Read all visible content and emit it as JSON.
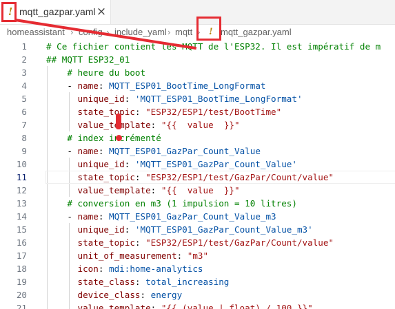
{
  "tab": {
    "warn_glyph": "!",
    "label": "mqtt_gazpar.yaml",
    "close_glyph": "×"
  },
  "breadcrumb": {
    "items": [
      "homeassistant",
      "config",
      "include_yaml",
      "mqtt"
    ],
    "separator": "›",
    "warn_glyph": "!",
    "file": "mqtt_gazpar.yaml"
  },
  "editor": {
    "current_line": 11,
    "lines": [
      {
        "n": "1",
        "segments": [
          {
            "t": "# Ce fichier contient les MQTT de l'ESP32. Il est impératif de m",
            "c": "comment"
          }
        ]
      },
      {
        "n": "2",
        "segments": [
          {
            "t": "## MQTT ESP32_01",
            "c": "comment"
          }
        ]
      },
      {
        "n": "3",
        "segments": [
          {
            "t": "    ",
            "c": "punct"
          },
          {
            "t": "# heure du boot",
            "c": "comment"
          }
        ]
      },
      {
        "n": "4",
        "segments": [
          {
            "t": "    - ",
            "c": "punct"
          },
          {
            "t": "name",
            "c": "key"
          },
          {
            "t": ": ",
            "c": "punct"
          },
          {
            "t": "MQTT_ESP01_BootTime_LongFormat",
            "c": "val"
          }
        ]
      },
      {
        "n": "5",
        "segments": [
          {
            "t": "      ",
            "c": "punct"
          },
          {
            "t": "unique_id",
            "c": "key"
          },
          {
            "t": ": ",
            "c": "punct"
          },
          {
            "t": "'MQTT_ESP01_BootTime_LongFormat'",
            "c": "val"
          }
        ]
      },
      {
        "n": "6",
        "segments": [
          {
            "t": "      ",
            "c": "punct"
          },
          {
            "t": "state_topic",
            "c": "key"
          },
          {
            "t": ": ",
            "c": "punct"
          },
          {
            "t": "\"ESP32/ESP1/test/BootTime\"",
            "c": "str"
          }
        ]
      },
      {
        "n": "7",
        "segments": [
          {
            "t": "      ",
            "c": "punct"
          },
          {
            "t": "value_template",
            "c": "key"
          },
          {
            "t": ": ",
            "c": "punct"
          },
          {
            "t": "\"{{  value  }}\"",
            "c": "str"
          }
        ]
      },
      {
        "n": "8",
        "segments": [
          {
            "t": "    ",
            "c": "punct"
          },
          {
            "t": "# index incrémenté",
            "c": "comment"
          }
        ]
      },
      {
        "n": "9",
        "segments": [
          {
            "t": "    - ",
            "c": "punct"
          },
          {
            "t": "name",
            "c": "key"
          },
          {
            "t": ": ",
            "c": "punct"
          },
          {
            "t": "MQTT_ESP01_GazPar_Count_Value",
            "c": "val"
          }
        ]
      },
      {
        "n": "10",
        "segments": [
          {
            "t": "      ",
            "c": "punct"
          },
          {
            "t": "unique_id",
            "c": "key"
          },
          {
            "t": ": ",
            "c": "punct"
          },
          {
            "t": "'MQTT_ESP01_GazPar_Count_Value'",
            "c": "val"
          }
        ]
      },
      {
        "n": "11",
        "segments": [
          {
            "t": "      ",
            "c": "punct"
          },
          {
            "t": "state_topic",
            "c": "key"
          },
          {
            "t": ": ",
            "c": "punct"
          },
          {
            "t": "\"ESP32/ESP1/test/GazPar/Count/value\"",
            "c": "str"
          }
        ]
      },
      {
        "n": "12",
        "segments": [
          {
            "t": "      ",
            "c": "punct"
          },
          {
            "t": "value_template",
            "c": "key"
          },
          {
            "t": ": ",
            "c": "punct"
          },
          {
            "t": "\"{{  value  }}\"",
            "c": "str"
          }
        ]
      },
      {
        "n": "13",
        "segments": [
          {
            "t": "    ",
            "c": "punct"
          },
          {
            "t": "# conversion en m3 (1 impulsion = 10 litres)",
            "c": "comment"
          }
        ]
      },
      {
        "n": "14",
        "segments": [
          {
            "t": "    - ",
            "c": "punct"
          },
          {
            "t": "name",
            "c": "key"
          },
          {
            "t": ": ",
            "c": "punct"
          },
          {
            "t": "MQTT_ESP01_GazPar_Count_Value_m3",
            "c": "val"
          }
        ]
      },
      {
        "n": "15",
        "segments": [
          {
            "t": "      ",
            "c": "punct"
          },
          {
            "t": "unique_id",
            "c": "key"
          },
          {
            "t": ": ",
            "c": "punct"
          },
          {
            "t": "'MQTT_ESP01_GazPar_Count_Value_m3'",
            "c": "val"
          }
        ]
      },
      {
        "n": "16",
        "segments": [
          {
            "t": "      ",
            "c": "punct"
          },
          {
            "t": "state_topic",
            "c": "key"
          },
          {
            "t": ": ",
            "c": "punct"
          },
          {
            "t": "\"ESP32/ESP1/test/GazPar/Count/value\"",
            "c": "str"
          }
        ]
      },
      {
        "n": "17",
        "segments": [
          {
            "t": "      ",
            "c": "punct"
          },
          {
            "t": "unit_of_measurement",
            "c": "key"
          },
          {
            "t": ": ",
            "c": "punct"
          },
          {
            "t": "\"m3\"",
            "c": "str"
          }
        ]
      },
      {
        "n": "18",
        "segments": [
          {
            "t": "      ",
            "c": "punct"
          },
          {
            "t": "icon",
            "c": "key"
          },
          {
            "t": ": ",
            "c": "punct"
          },
          {
            "t": "mdi:home-analytics",
            "c": "val"
          }
        ]
      },
      {
        "n": "19",
        "segments": [
          {
            "t": "      ",
            "c": "punct"
          },
          {
            "t": "state_class",
            "c": "key"
          },
          {
            "t": ": ",
            "c": "punct"
          },
          {
            "t": "total_increasing",
            "c": "val"
          }
        ]
      },
      {
        "n": "20",
        "segments": [
          {
            "t": "      ",
            "c": "punct"
          },
          {
            "t": "device_class",
            "c": "key"
          },
          {
            "t": ": ",
            "c": "punct"
          },
          {
            "t": "energy",
            "c": "val"
          }
        ]
      },
      {
        "n": "21",
        "segments": [
          {
            "t": "      ",
            "c": "punct"
          },
          {
            "t": "value_template",
            "c": "key"
          },
          {
            "t": ": ",
            "c": "punct"
          },
          {
            "t": "\"{{ (value | float) / 100 }}\"",
            "c": "str"
          }
        ]
      }
    ]
  },
  "colors": {
    "comment": "#008000",
    "key": "#800000",
    "string": "#a31515",
    "value": "#0451a5",
    "annotation": "#e52b32",
    "warning": "#b8860b"
  }
}
